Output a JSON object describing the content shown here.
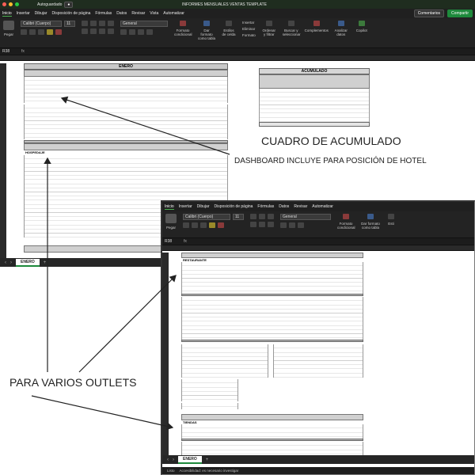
{
  "window1": {
    "autosave_label": "Autoguardado",
    "title": "INFORMES MENSUALES VENTAS TEMPLATE",
    "menu": [
      "Inicio",
      "Insertar",
      "Dibujar",
      "Disposición de página",
      "Fórmulas",
      "Datos",
      "Revisar",
      "Vista",
      "Automatizar"
    ],
    "comments_label": "Comentarios",
    "share_label": "Compartir",
    "paste_label": "Pegar",
    "font_name": "Calibri (Cuerpo)",
    "font_size": "11",
    "number_format": "General",
    "ribbon_labels": [
      "Formato condicional",
      "Dar formato como tabla",
      "Estilos de celda",
      "Insertar",
      "Eliminar",
      "Formato",
      "Ordenar y filtrar",
      "Buscar y seleccionar",
      "Complementos",
      "Analizar datos",
      "Copilot"
    ],
    "name_box": "R38",
    "fx": "fx",
    "sheet_title": "ENERO",
    "summary_title": "ACUMULADO",
    "section_hospedaje": "HOSPEDAJE",
    "sheet_tab": "ENERO",
    "add_tab": "+"
  },
  "window2": {
    "menu": [
      "Inicio",
      "Insertar",
      "Dibujar",
      "Disposición de página",
      "Fórmulas",
      "Datos",
      "Revisar",
      "Automatizar"
    ],
    "paste_label": "Pegar",
    "font_name": "Calibri (Cuerpo)",
    "font_size": "11",
    "number_format": "General",
    "ribbon_labels": [
      "Formato condicional",
      "Dar formato como tabla",
      "Esti"
    ],
    "name_box": "R38",
    "fx": "fx",
    "section_restaurante": "RESTAURANTE",
    "section_tiendas": "TIENDAS",
    "sheet_tab": "ENERO",
    "add_tab": "+",
    "status_ready": "Listo",
    "status_accessibility": "Accesibilidad: es necesario investigar"
  },
  "annotations": {
    "cuadro": "CUADRO DE ACUMULADO",
    "dashboard": "DASHBOARD INCLUYE PARA POSICIÓN DE HOTEL",
    "outlets": "PARA VARIOS OUTLETS"
  }
}
